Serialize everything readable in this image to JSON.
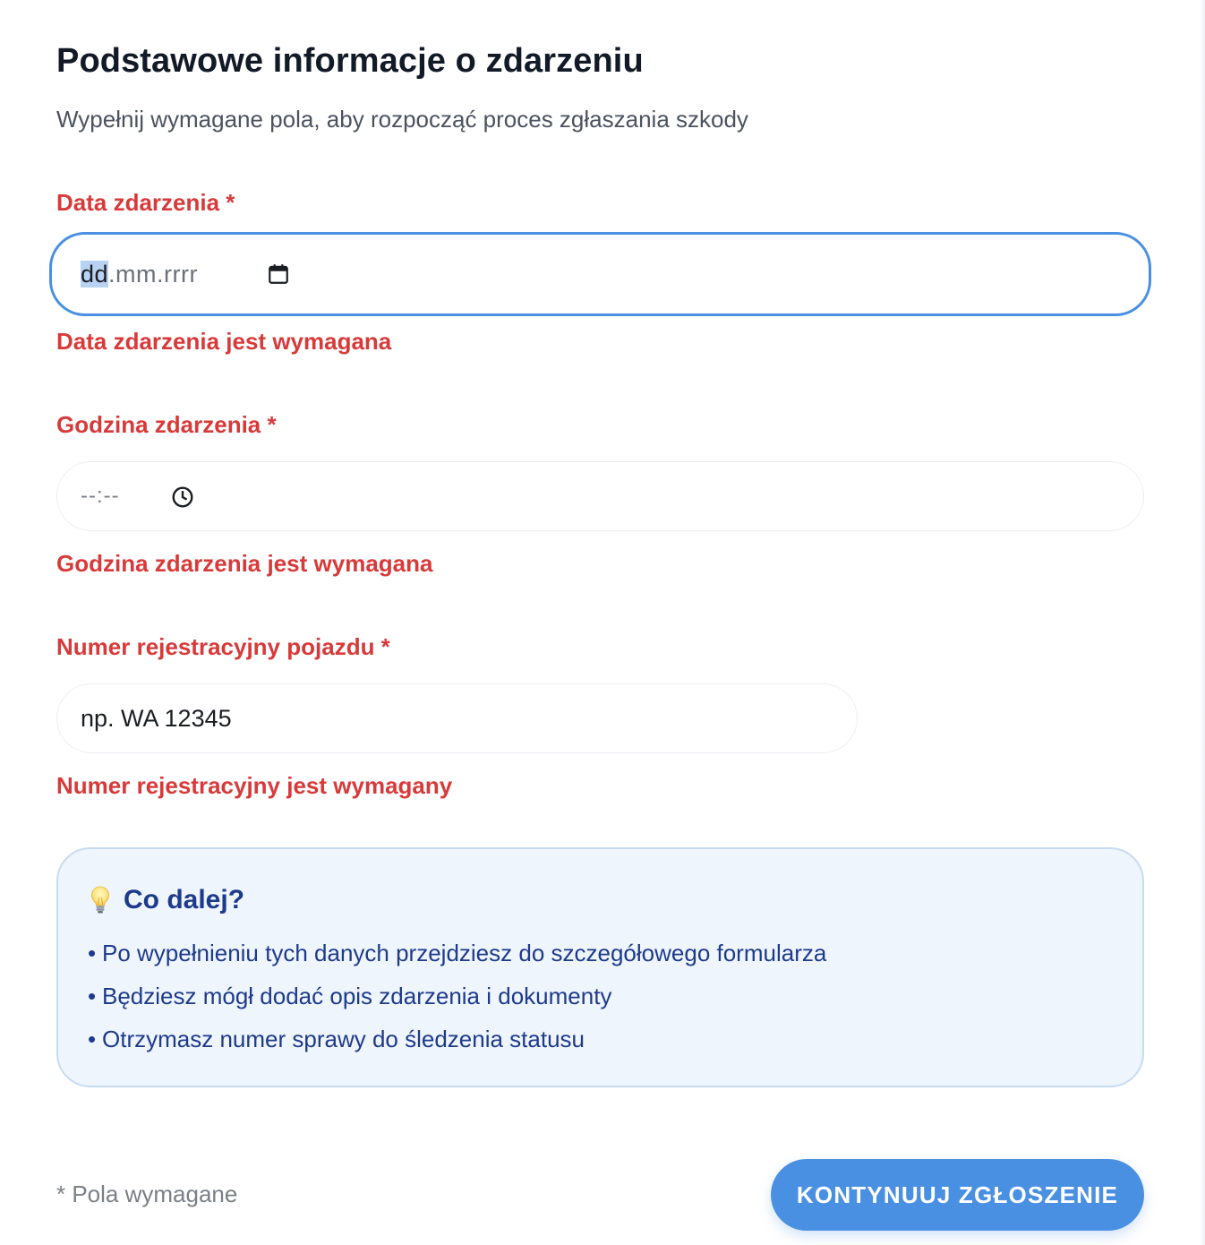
{
  "header": {
    "title": "Podstawowe informacje o zdarzeniu",
    "subtitle": "Wypełnij wymagane pola, aby rozpocząć proces zgłaszania szkody"
  },
  "fields": {
    "date": {
      "label": "Data zdarzenia *",
      "placeholder_selected": "dd",
      "placeholder_rest": ".mm.rrrr",
      "error": "Data zdarzenia jest wymagana",
      "icon": "calendar-icon"
    },
    "time": {
      "label": "Godzina zdarzenia *",
      "placeholder": "--:--",
      "error": "Godzina zdarzenia jest wymagana",
      "icon": "clock-icon"
    },
    "plate": {
      "label": "Numer rejestracyjny pojazdu *",
      "placeholder": "np. WA 12345",
      "error": "Numer rejestracyjny jest wymagany"
    }
  },
  "info": {
    "icon": "lightbulb-icon",
    "title": "Co dalej?",
    "items": [
      "Po wypełnieniu tych danych przejdziesz do szczegółowego formularza",
      "Będziesz mógł dodać opis zdarzenia i dokumenty",
      "Otrzymasz numer sprawy do śledzenia statusu"
    ]
  },
  "footer": {
    "required_note": "* Pola wymagane",
    "submit_label": "KONTYNUUJ ZGŁOSZENIE"
  },
  "colors": {
    "primary": "#4a90e2",
    "error": "#d83a3a",
    "info_text": "#1e3a8a",
    "info_bg": "#eef5fd"
  }
}
